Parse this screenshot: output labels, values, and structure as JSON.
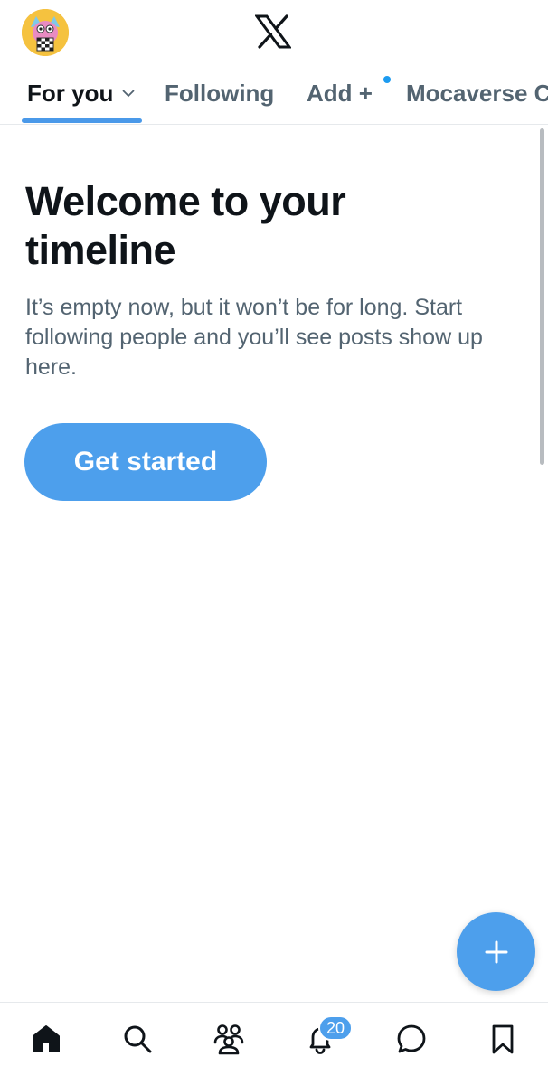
{
  "header": {
    "avatar_icon": "profile-avatar",
    "logo_icon": "x-logo"
  },
  "tabs": [
    {
      "label": "For you",
      "active": true,
      "icon": "chevron-down-icon"
    },
    {
      "label": "Following"
    },
    {
      "label": "Add +",
      "has_dot": true
    },
    {
      "label": "Mocaverse C"
    }
  ],
  "empty_state": {
    "title": "Welcome to your timeline",
    "body": "It’s empty now, but it won’t be for long. Start following people and you’ll see posts show up here.",
    "button_label": "Get started"
  },
  "fab": {
    "icon": "plus-icon"
  },
  "bottom_nav": {
    "items": [
      "home-icon",
      "search-icon",
      "communities-icon",
      "notifications-icon",
      "messages-icon",
      "bookmarks-icon"
    ],
    "notifications_badge": "20"
  },
  "colors": {
    "accent": "#4d9fec",
    "text_primary": "#0f1419",
    "text_secondary": "#536471"
  }
}
